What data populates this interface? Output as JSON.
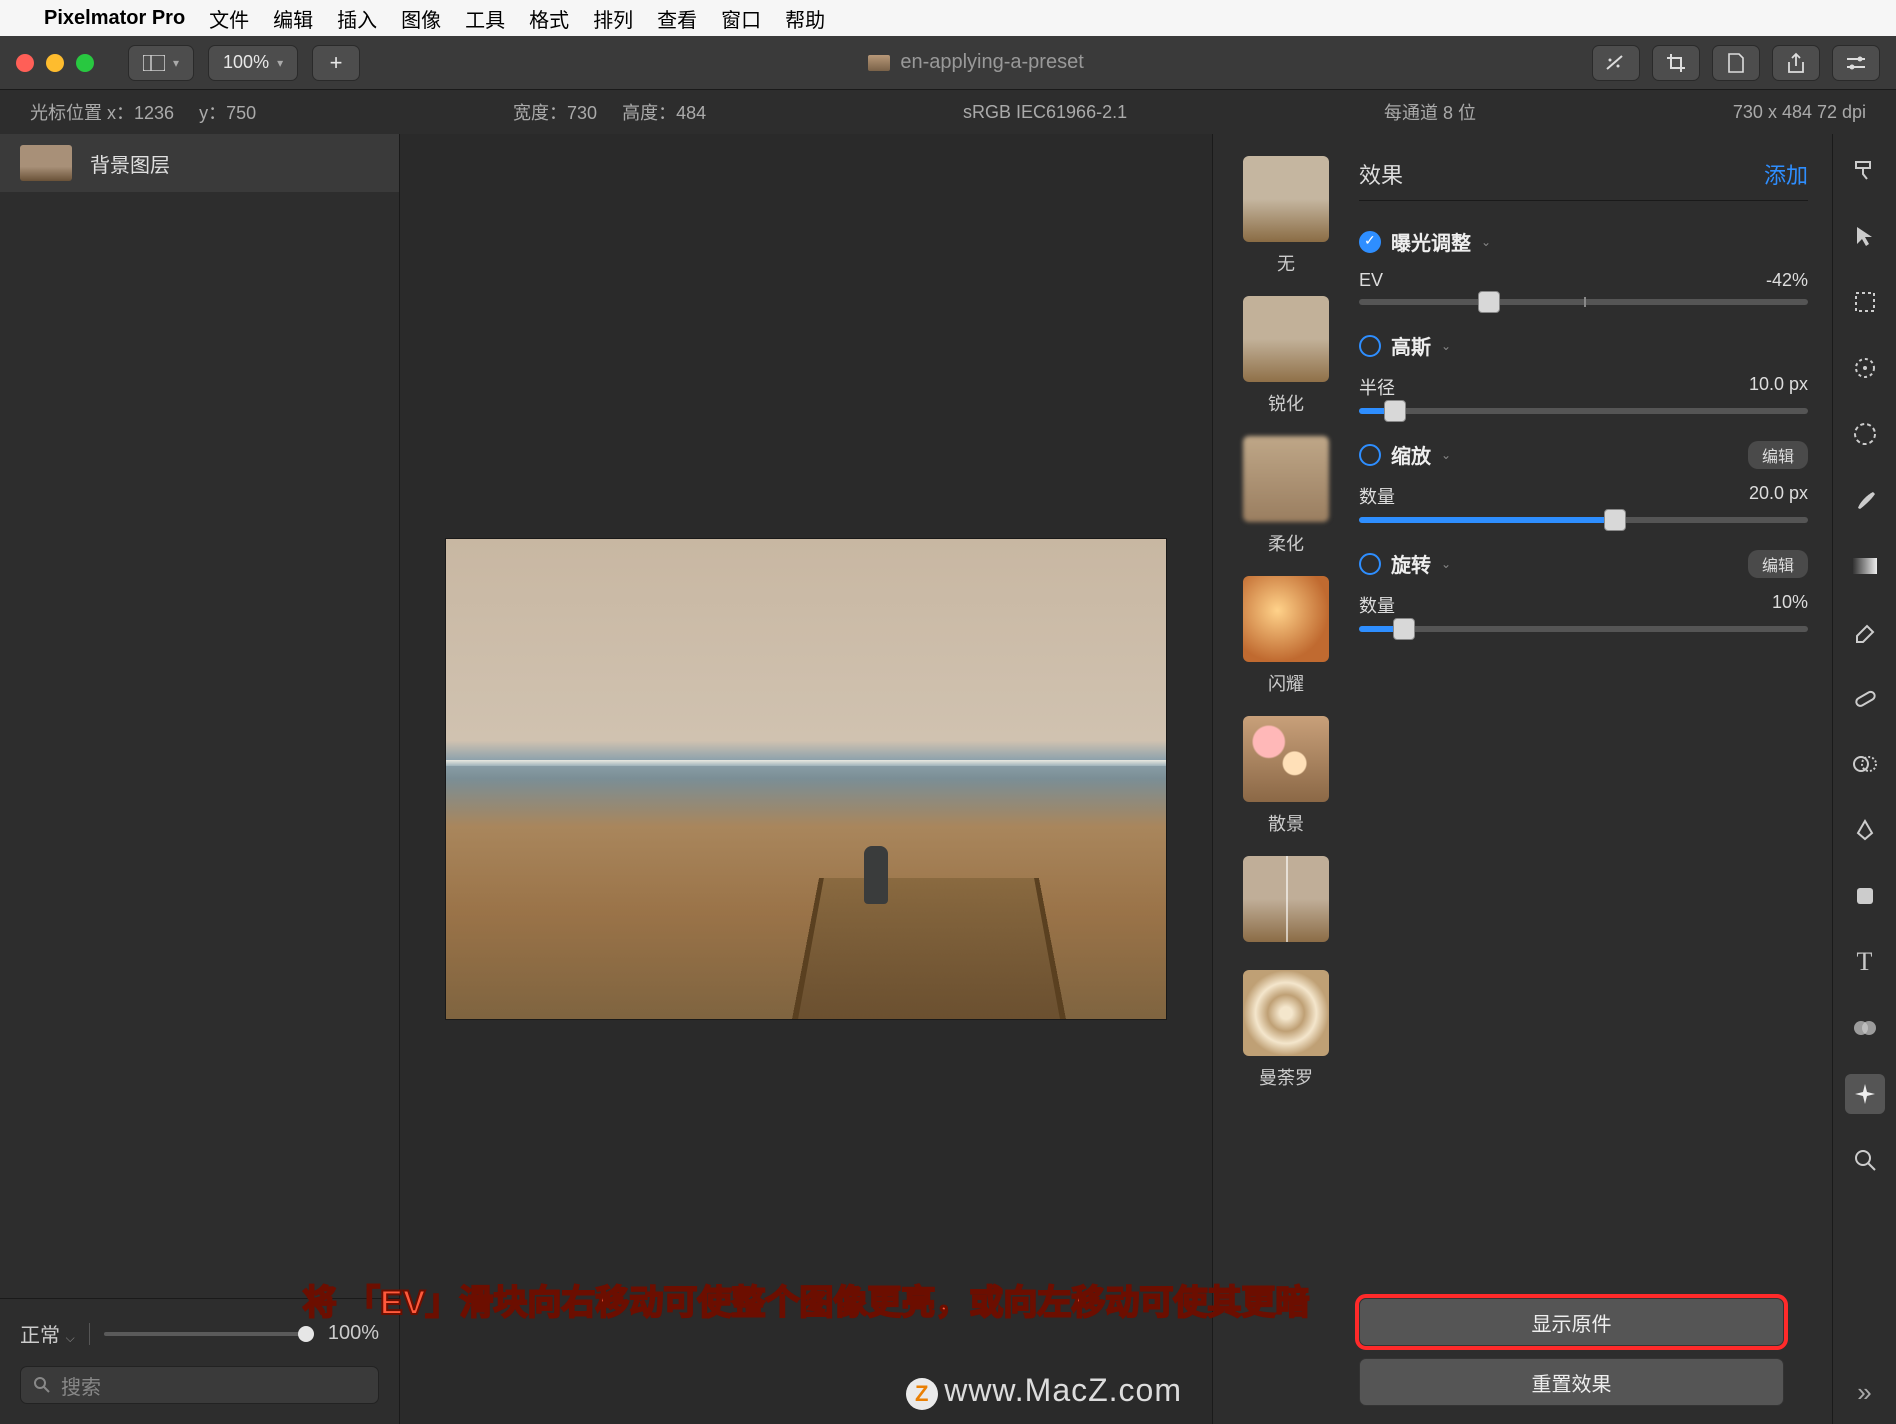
{
  "menubar": {
    "appname": "Pixelmator Pro",
    "items": [
      "文件",
      "编辑",
      "插入",
      "图像",
      "工具",
      "格式",
      "排列",
      "查看",
      "窗口",
      "帮助"
    ]
  },
  "window": {
    "zoom": "100%",
    "title": "en-applying-a-preset"
  },
  "infobar": {
    "cursor_label": "光标位置 x：",
    "cursor_x": "1236",
    "cursor_y_label": "y：",
    "cursor_y": "750",
    "width_label": "宽度：",
    "width": "730",
    "height_label": "高度：",
    "height": "484",
    "colorspace": "sRGB IEC61966-2.1",
    "bitdepth": "每通道 8 位",
    "dims": "730 x 484 72 dpi"
  },
  "layers": {
    "items": [
      {
        "name": "背景图层"
      }
    ],
    "blend_mode": "正常",
    "opacity": "100%",
    "search_placeholder": "搜索"
  },
  "effects": {
    "title": "效果",
    "add_label": "添加",
    "presets": [
      {
        "key": "none",
        "label": "无"
      },
      {
        "key": "sharpen",
        "label": "锐化"
      },
      {
        "key": "soften",
        "label": "柔化"
      },
      {
        "key": "sparkle",
        "label": "闪耀"
      },
      {
        "key": "bokeh",
        "label": "散景"
      },
      {
        "key": "preset6",
        "label": ""
      },
      {
        "key": "mandala",
        "label": "曼荼罗"
      }
    ],
    "list": [
      {
        "name": "曝光调整",
        "checked": true,
        "param_label": "EV",
        "param_value": "-42%",
        "pos": 29
      },
      {
        "name": "高斯",
        "checked": false,
        "param_label": "半径",
        "param_value": "10.0 px",
        "pos": 8,
        "fill": 8
      },
      {
        "name": "缩放",
        "checked": false,
        "param_label": "数量",
        "param_value": "20.0 px",
        "pos": 57,
        "fill": 57,
        "edit": "编辑"
      },
      {
        "name": "旋转",
        "checked": false,
        "param_label": "数量",
        "param_value": "10%",
        "pos": 10,
        "fill": 10,
        "edit": "编辑"
      }
    ],
    "show_original": "显示原件",
    "reset": "重置效果"
  },
  "overlay": "将 「EV」滑块向右移动可使整个图像更亮，或向左移动可使其更暗",
  "watermark": "www.MacZ.com"
}
